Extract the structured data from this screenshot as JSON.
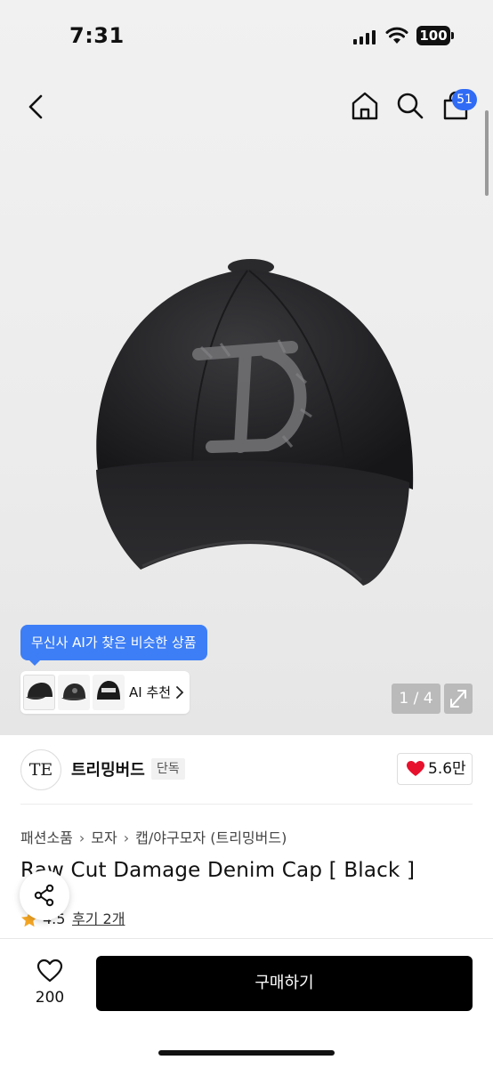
{
  "status_bar": {
    "time": "7:31",
    "battery": "100"
  },
  "header": {
    "cart_count": "51"
  },
  "gallery": {
    "ai_tooltip": "무신사 AI가 찾은 비슷한 상품",
    "ai_label": "AI 추천",
    "page_counter": "1 / 4"
  },
  "brand": {
    "logo_text": "TE",
    "name": "트리밍버드",
    "badge": "단독",
    "likes": "5.6만"
  },
  "breadcrumb": [
    "패션소품",
    "모자",
    "캡/야구모자 (트리밍버드)"
  ],
  "product": {
    "title": "Raw Cut Damage Denim Cap [ Black ]",
    "rating": "4.5",
    "reviews": "후기 2개"
  },
  "bottom_bar": {
    "wish_count": "200",
    "buy_label": "구매하기"
  },
  "colors": {
    "accent_blue": "#3d7ef6",
    "badge_blue": "#2f6bf4",
    "heart_red": "#e8112d",
    "star_orange": "#f5a623"
  }
}
